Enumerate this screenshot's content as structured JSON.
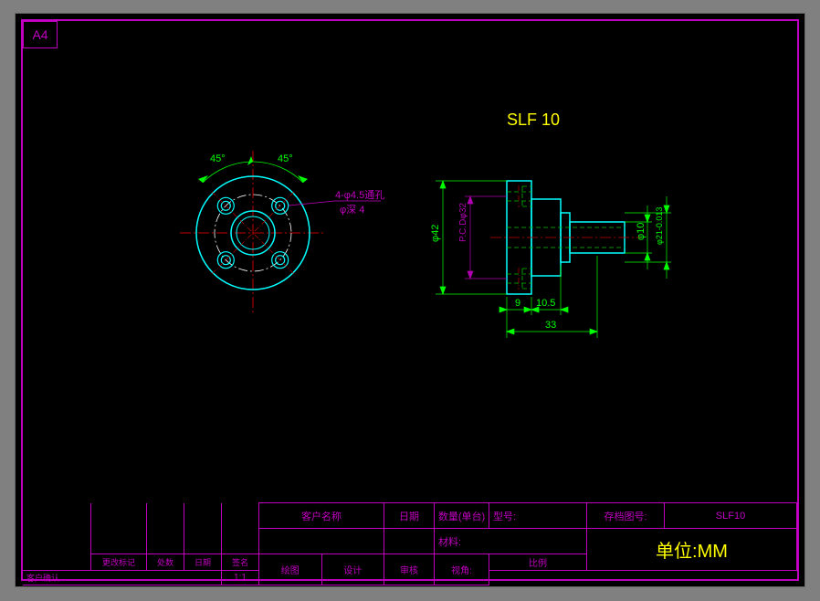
{
  "frame": {
    "size_label": "A4"
  },
  "part": {
    "title": "SLF 10",
    "archive_code": "SLF10"
  },
  "front_view": {
    "angle1": "45°",
    "angle2": "45°",
    "hole_callout_1": "4-φ4.5通孔",
    "hole_callout_2": "φ深 4"
  },
  "side_view": {
    "dim_outer_dia": "φ42",
    "dim_pcd": "P.C.Dφ32",
    "dim_shaft_dia": "φ10",
    "dim_bore": "φ21-0.013",
    "dim_flange_thk": "9",
    "dim_step": "10.5",
    "dim_length": "33"
  },
  "title_block": {
    "r1_c1": "客户名称",
    "r1_c2": "日期",
    "r1_c3": "数量(单台)",
    "r1_c3b": "型号:",
    "r1_c4": "存档图号:",
    "r2_c3": "材料:",
    "col_revmark": "更改标记",
    "col_place": "处数",
    "col_date": "日期",
    "col_sign": "签名",
    "row_confirm": "客户确认",
    "lbl_draw": "绘图",
    "lbl_design": "设计",
    "lbl_check": "审核",
    "lbl_view": "视角:",
    "lbl_scale": "比例",
    "scale_val": "1:1",
    "unit": "单位:MM"
  }
}
